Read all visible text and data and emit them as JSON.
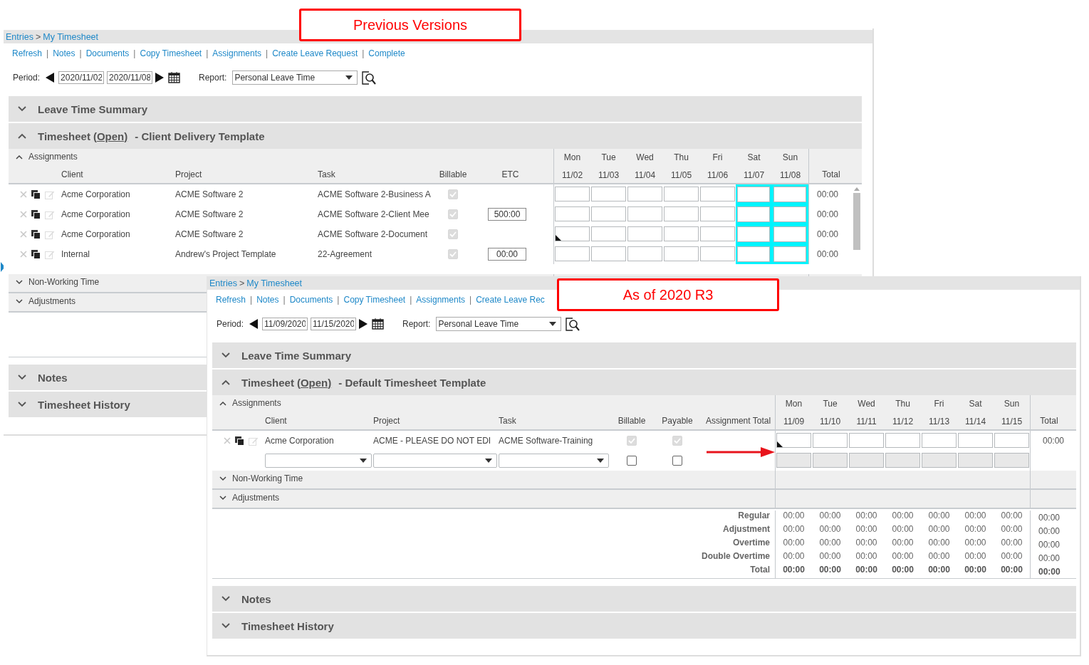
{
  "callouts": [
    {
      "text": "Previous Versions"
    },
    {
      "text": "As of 2020 R3"
    }
  ],
  "windows": [
    {
      "breadcrumb": {
        "items": [
          "Entries",
          "My Timesheet"
        ],
        "separator": ">"
      },
      "links": [
        "Refresh",
        "Notes",
        "Documents",
        "Copy Timesheet",
        "Assignments",
        "Create Leave Request",
        "Complete"
      ],
      "link_separator": "|",
      "period": {
        "label": "Period:",
        "start": "2020/11/02",
        "end": "2020/11/08"
      },
      "report": {
        "label": "Report:",
        "value": "Personal Leave Time"
      },
      "leave_summary": {
        "title": "Leave Time Summary",
        "expanded": false
      },
      "timesheet": {
        "title": "Timesheet",
        "status": "(Open)",
        "template": "- Client Delivery Template",
        "expanded": true
      },
      "assignments": {
        "title": "Assignments",
        "expanded": true
      },
      "columns": [
        "Client",
        "Project",
        "Task",
        "Billable",
        "ETC"
      ],
      "days": [
        {
          "day": "Mon",
          "date": "11/02",
          "highlighted": false
        },
        {
          "day": "Tue",
          "date": "11/03",
          "highlighted": false
        },
        {
          "day": "Wed",
          "date": "11/04",
          "highlighted": false
        },
        {
          "day": "Thu",
          "date": "11/05",
          "highlighted": false
        },
        {
          "day": "Fri",
          "date": "11/06",
          "highlighted": false
        },
        {
          "day": "Sat",
          "date": "11/07",
          "highlighted": true
        },
        {
          "day": "Sun",
          "date": "11/08",
          "highlighted": true
        }
      ],
      "total_header": "Total",
      "rows": [
        {
          "kind": "assignment",
          "client": "Acme Corporation",
          "project": "ACME Software 2",
          "task": "ACME Software 2-Business A",
          "billable": true,
          "total": "00:00",
          "marker": false
        },
        {
          "kind": "assignment",
          "client": "Acme Corporation",
          "project": "ACME Software 2",
          "task": "ACME Software 2-Client Mee",
          "billable": true,
          "etc": "500:00",
          "total": "00:00",
          "marker": false
        },
        {
          "kind": "assignment",
          "client": "Acme Corporation",
          "project": "ACME Software 2",
          "task": "ACME Software 2-Document",
          "billable": true,
          "total": "00:00",
          "marker": true
        },
        {
          "kind": "assignment",
          "client": "Internal",
          "project": "Andrew's Project Template",
          "task": "22-Agreement",
          "billable": true,
          "etc": "00:00",
          "total": "00:00",
          "marker": false
        }
      ],
      "subsections": [
        {
          "title": "Non-Working Time",
          "expanded": false
        },
        {
          "title": "Adjustments",
          "expanded": false
        }
      ],
      "panels": [
        {
          "title": "Notes",
          "expanded": false
        },
        {
          "title": "Timesheet History",
          "expanded": false
        }
      ]
    },
    {
      "breadcrumb": {
        "items": [
          "Entries",
          "My Timesheet"
        ],
        "separator": ">"
      },
      "links": [
        "Refresh",
        "Notes",
        "Documents",
        "Copy Timesheet",
        "Assignments",
        "Create Leave Rec"
      ],
      "link_separator": "|",
      "period": {
        "label": "Period:",
        "start": "11/09/2020",
        "end": "11/15/2020"
      },
      "report": {
        "label": "Report:",
        "value": "Personal Leave Time"
      },
      "leave_summary": {
        "title": "Leave Time Summary",
        "expanded": false
      },
      "timesheet": {
        "title": "Timesheet",
        "status": "(Open)",
        "template": "- Default Timesheet Template",
        "expanded": true
      },
      "assignments": {
        "title": "Assignments",
        "expanded": true
      },
      "columns": [
        "Client",
        "Project",
        "Task",
        "Billable",
        "Payable",
        "Assignment Total"
      ],
      "days": [
        {
          "day": "Mon",
          "date": "11/09",
          "highlighted": false
        },
        {
          "day": "Tue",
          "date": "11/10",
          "highlighted": false
        },
        {
          "day": "Wed",
          "date": "11/11",
          "highlighted": false
        },
        {
          "day": "Thu",
          "date": "11/12",
          "highlighted": false
        },
        {
          "day": "Fri",
          "date": "11/13",
          "highlighted": false
        },
        {
          "day": "Sat",
          "date": "11/14",
          "highlighted": false
        },
        {
          "day": "Sun",
          "date": "11/15",
          "highlighted": false
        }
      ],
      "total_header": "Total",
      "rows": [
        {
          "kind": "assignment",
          "client": "Acme Corporation",
          "project": "ACME - PLEASE DO NOT EDI",
          "task": "ACME Software-Training",
          "billable": true,
          "payable": true,
          "total": "00:00",
          "marker": true
        },
        {
          "kind": "entry",
          "billable": false,
          "payable": false
        }
      ],
      "subsections": [
        {
          "title": "Non-Working Time",
          "expanded": false
        },
        {
          "title": "Adjustments",
          "expanded": false
        }
      ],
      "totals": [
        {
          "label": "Regular",
          "values": [
            "00:00",
            "00:00",
            "00:00",
            "00:00",
            "00:00",
            "00:00",
            "00:00"
          ],
          "total": "00:00",
          "bold": false
        },
        {
          "label": "Adjustment",
          "values": [
            "00:00",
            "00:00",
            "00:00",
            "00:00",
            "00:00",
            "00:00",
            "00:00"
          ],
          "total": "00:00",
          "bold": false
        },
        {
          "label": "Overtime",
          "values": [
            "00:00",
            "00:00",
            "00:00",
            "00:00",
            "00:00",
            "00:00",
            "00:00"
          ],
          "total": "00:00",
          "bold": false
        },
        {
          "label": "Double Overtime",
          "values": [
            "00:00",
            "00:00",
            "00:00",
            "00:00",
            "00:00",
            "00:00",
            "00:00"
          ],
          "total": "00:00",
          "bold": false
        },
        {
          "label": "Total",
          "values": [
            "00:00",
            "00:00",
            "00:00",
            "00:00",
            "00:00",
            "00:00",
            "00:00"
          ],
          "total": "00:00",
          "bold": true
        }
      ],
      "panels": [
        {
          "title": "Notes",
          "expanded": false
        },
        {
          "title": "Timesheet History",
          "expanded": false
        }
      ]
    }
  ]
}
